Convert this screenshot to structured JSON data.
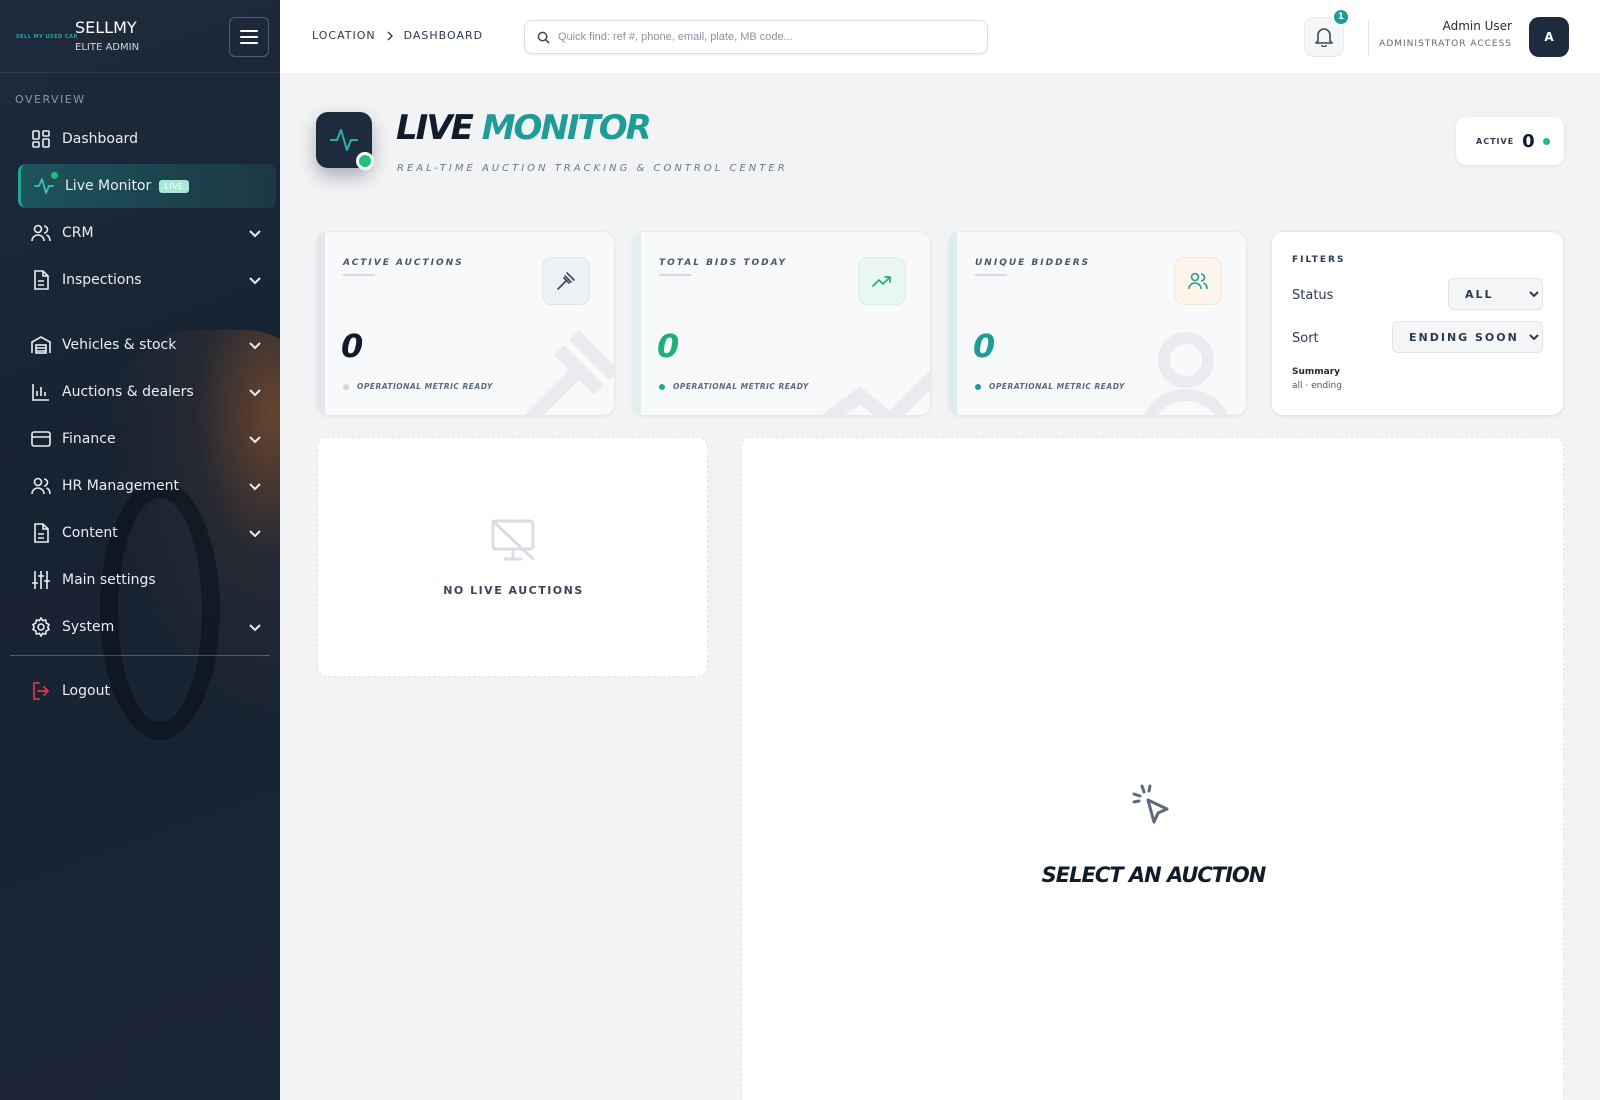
{
  "brand": {
    "logo_text": "SELL MY USED CAR",
    "name": "SELLMY",
    "subtitle": "ELITE ADMIN"
  },
  "sidebar": {
    "section": "OVERVIEW",
    "items": [
      {
        "label": "Dashboard",
        "icon": "dashboard-grid-icon"
      },
      {
        "label": "Live Monitor",
        "icon": "activity-pulse-icon",
        "badge": "LIVE",
        "active": true
      },
      {
        "label": "CRM",
        "icon": "users-icon",
        "expandable": true
      },
      {
        "label": "Inspections",
        "icon": "document-icon",
        "expandable": true
      },
      {
        "label": "Vehicles & stock",
        "icon": "garage-icon",
        "expandable": true
      },
      {
        "label": "Auctions & dealers",
        "icon": "bar-chart-icon",
        "expandable": true
      },
      {
        "label": "Finance",
        "icon": "credit-card-icon",
        "expandable": true
      },
      {
        "label": "HR Management",
        "icon": "users-icon",
        "expandable": true
      },
      {
        "label": "Content",
        "icon": "document-icon",
        "expandable": true
      },
      {
        "label": "Main settings",
        "icon": "sliders-icon"
      },
      {
        "label": "System",
        "icon": "gear-icon",
        "expandable": true
      }
    ],
    "logout": "Logout"
  },
  "topbar": {
    "breadcrumb": [
      "LOCATION",
      "DASHBOARD"
    ],
    "search_placeholder": "Quick find: ref #, phone, email, plate, MB code...",
    "notifications_count": "1",
    "user_name": "Admin User",
    "user_role": "ADMINISTRATOR ACCESS",
    "avatar_initial": "A"
  },
  "header": {
    "title_part1": "LIVE",
    "title_part2": "MONITOR",
    "subtitle": "REAL-TIME AUCTION TRACKING & CONTROL CENTER",
    "active_label": "ACTIVE",
    "active_value": "0"
  },
  "stats": [
    {
      "label": "ACTIVE AUCTIONS",
      "value": "0",
      "meta": "OPERATIONAL METRIC READY",
      "icon": "gavel-icon",
      "color": "#111c2b",
      "dot": "#cfd5dc"
    },
    {
      "label": "TOTAL BIDS TODAY",
      "value": "0",
      "meta": "OPERATIONAL METRIC READY",
      "icon": "trending-up-icon",
      "color": "#1fb07a",
      "dot": "#1fb07a"
    },
    {
      "label": "UNIQUE BIDDERS",
      "value": "0",
      "meta": "OPERATIONAL METRIC READY",
      "icon": "users-icon",
      "color": "#1f9c98",
      "dot": "#1f9c98"
    }
  ],
  "filters": {
    "title": "FILTERS",
    "status_label": "Status",
    "status_value": "ALL",
    "sort_label": "Sort",
    "sort_value": "ENDING SOON",
    "summary_title": "Summary",
    "summary_value": "all · ending"
  },
  "list_panel": {
    "empty_text": "NO LIVE AUCTIONS"
  },
  "detail_panel": {
    "empty_text": "SELECT AN AUCTION"
  },
  "colors": {
    "accent": "#1f9c98",
    "success": "#20c07a",
    "sidebar_bg": "#1a2535",
    "danger": "#e0354a"
  }
}
